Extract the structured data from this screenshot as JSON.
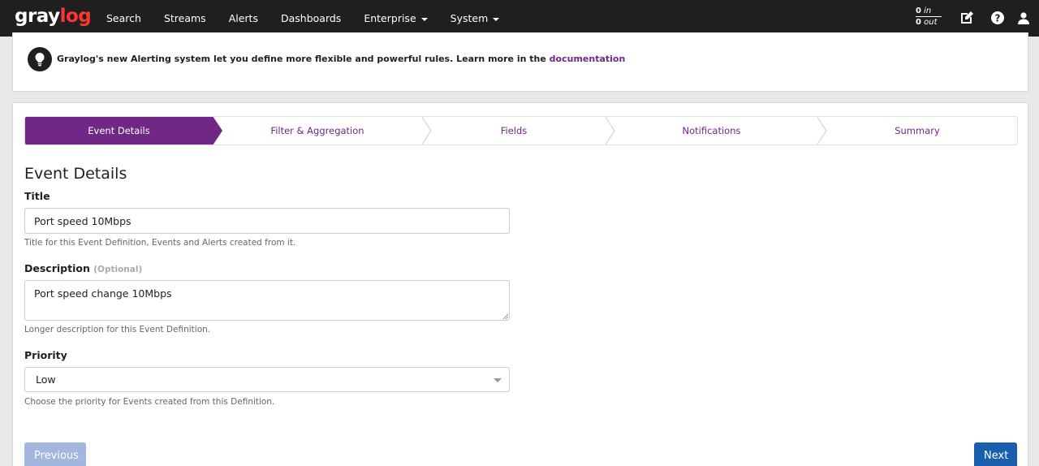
{
  "brand": {
    "part1": "gray",
    "part2": "log"
  },
  "nav": {
    "items": [
      {
        "label": "Search"
      },
      {
        "label": "Streams"
      },
      {
        "label": "Alerts"
      },
      {
        "label": "Dashboards"
      },
      {
        "label": "Enterprise",
        "dropdown": true
      },
      {
        "label": "System",
        "dropdown": true
      }
    ],
    "throughput": {
      "in_value": "0",
      "in_label": "in",
      "out_value": "0",
      "out_label": "out"
    },
    "icons": [
      "edit-icon",
      "help-icon",
      "user-icon"
    ]
  },
  "notice": {
    "text": "Graylog's new Alerting system let you define more flexible and powerful rules. Learn more in the",
    "link": "documentation",
    "icon": "lightbulb-icon"
  },
  "wizard": {
    "steps": [
      {
        "label": "Event Details",
        "active": true
      },
      {
        "label": "Filter & Aggregation"
      },
      {
        "label": "Fields"
      },
      {
        "label": "Notifications"
      },
      {
        "label": "Summary"
      }
    ]
  },
  "form": {
    "section_title": "Event Details",
    "title": {
      "label": "Title",
      "value": "Port speed 10Mbps",
      "help": "Title for this Event Definition, Events and Alerts created from it."
    },
    "description": {
      "label": "Description",
      "optional": "(Optional)",
      "value": "Port speed change 10Mbps",
      "help": "Longer description for this Event Definition."
    },
    "priority": {
      "label": "Priority",
      "value": "Low",
      "help": "Choose the priority for Events created from this Definition."
    }
  },
  "buttons": {
    "previous": "Previous",
    "next": "Next"
  },
  "colors": {
    "navbar": "#1f1f1f",
    "accent": "#702785",
    "brand_red": "#ff3633",
    "primary": "#1a5fae",
    "disabled": "#a3b6e0"
  }
}
